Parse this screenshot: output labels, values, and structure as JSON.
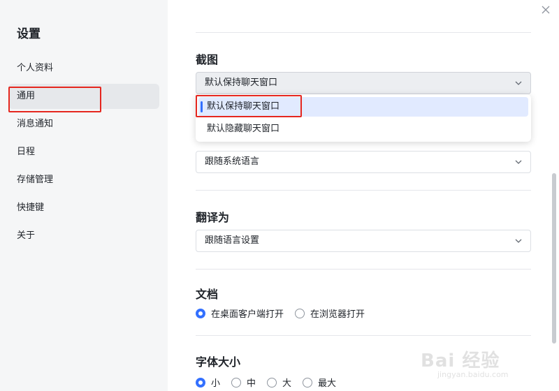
{
  "sidebar": {
    "title": "设置",
    "items": [
      {
        "label": "个人资料"
      },
      {
        "label": "通用"
      },
      {
        "label": "消息通知"
      },
      {
        "label": "日程"
      },
      {
        "label": "存储管理"
      },
      {
        "label": "快捷键"
      },
      {
        "label": "关于"
      }
    ],
    "active_item": "通用"
  },
  "main": {
    "screenshot_section": {
      "title": "截图",
      "select_value": "默认保持聊天窗口",
      "options": [
        "默认保持聊天窗口",
        "默认隐藏聊天窗口"
      ],
      "selected_option": "默认保持聊天窗口"
    },
    "language_section": {
      "select_value": "跟随系统语言"
    },
    "translate_section": {
      "title": "翻译为",
      "select_value": "跟随语言设置"
    },
    "document_section": {
      "title": "文档",
      "options": [
        "在桌面客户端打开",
        "在浏览器打开"
      ],
      "selected": "在桌面客户端打开"
    },
    "font_size_section": {
      "title": "字体大小",
      "options": [
        "小",
        "中",
        "大",
        "最大"
      ],
      "selected": "小"
    }
  },
  "watermark": {
    "main": "Bai 经验",
    "sub": "jingyan.baidu.com"
  },
  "colors": {
    "accent": "#3370ff",
    "highlight_box": "#e5271f",
    "sidebar_bg": "#f5f6f7"
  },
  "icons": {
    "close": "close-icon",
    "chevron": "chevron-down-icon"
  }
}
